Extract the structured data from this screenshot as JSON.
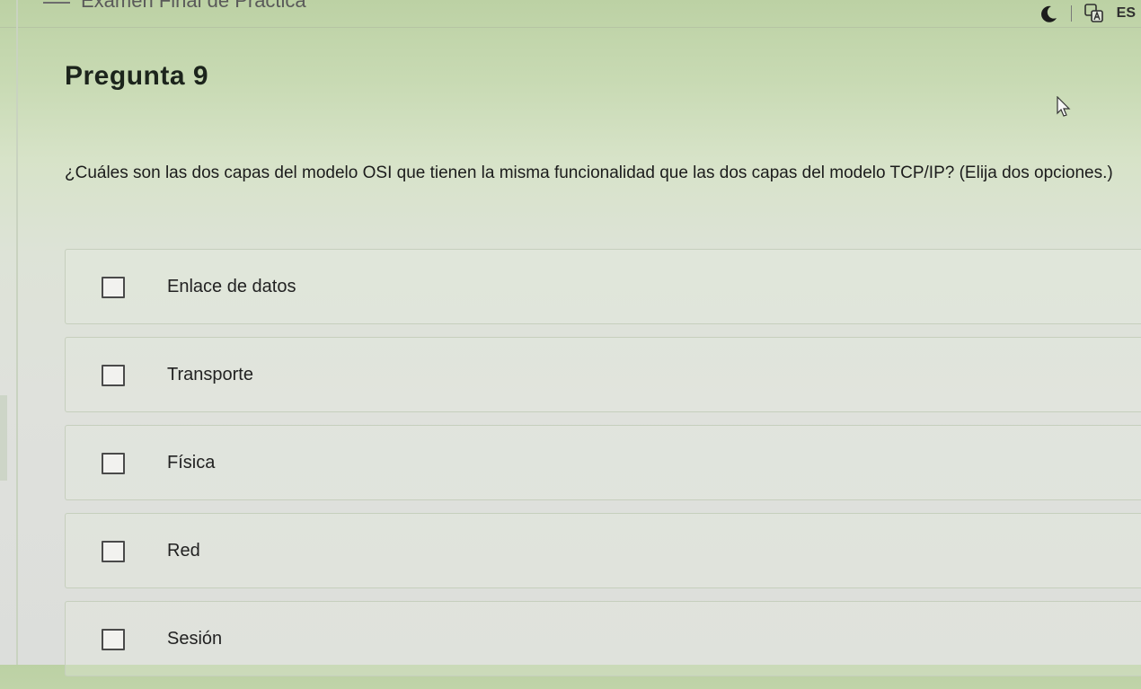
{
  "header": {
    "title": "Examen Final de Práctica",
    "language_code": "ES",
    "icons": [
      "moon-icon",
      "translate-icon"
    ]
  },
  "question": {
    "title": "Pregunta 9",
    "text": "¿Cuáles son las dos capas del modelo OSI que tienen la misma funcionalidad que las dos capas del modelo TCP/IP?  (Elija dos opciones.)",
    "options": [
      {
        "label": "Enlace de datos",
        "checked": false
      },
      {
        "label": "Transporte",
        "checked": false
      },
      {
        "label": "Física",
        "checked": false
      },
      {
        "label": "Red",
        "checked": false
      },
      {
        "label": "Sesión",
        "checked": false
      }
    ]
  },
  "colors": {
    "background_top": "#bcd1a4",
    "background_bottom": "#dcdedb",
    "text": "#1c1c1c",
    "checkbox_border": "#4a4a4a"
  }
}
